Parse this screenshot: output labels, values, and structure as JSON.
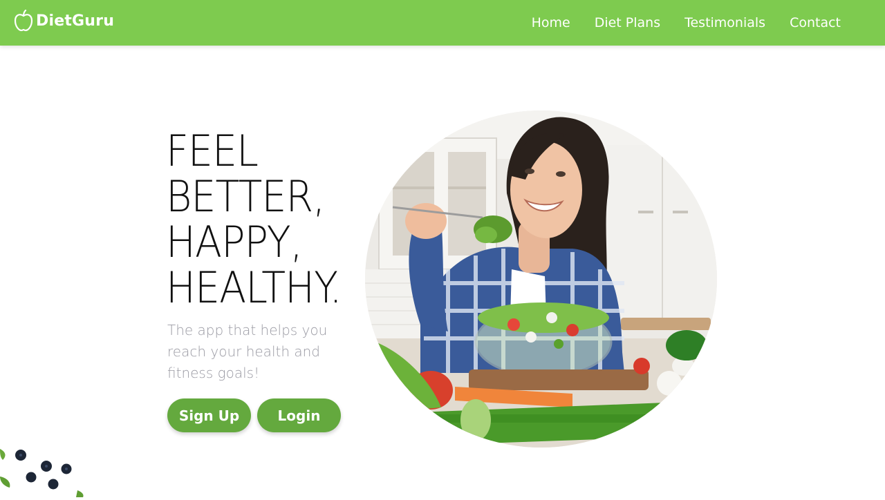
{
  "nav": {
    "brand": "DietGuru",
    "links": [
      "Home",
      "Diet Plans",
      "Testimonials",
      "Contact"
    ]
  },
  "hero": {
    "title_lines": [
      "FEEL",
      "BETTER,",
      "HAPPY,",
      "HEALTHY."
    ],
    "subtitle": "The app that helps you reach your health and fitness goals!",
    "signup_label": "Sign Up",
    "login_label": "Login"
  },
  "colors": {
    "nav_bg": "#7ecb4f",
    "button_bg": "#64a93e",
    "subtitle": "#9a9aa3"
  },
  "icons": {
    "brand": "apple-icon"
  }
}
